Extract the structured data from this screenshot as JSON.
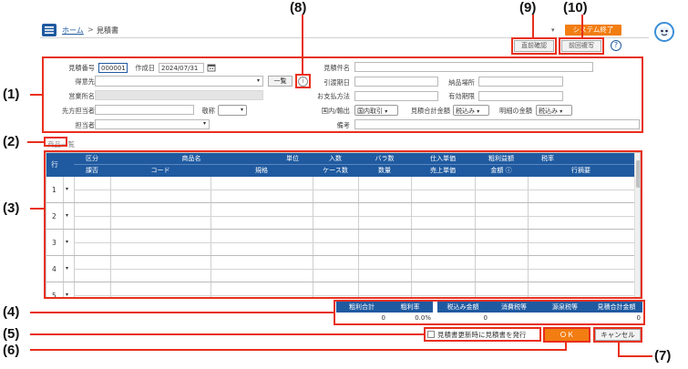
{
  "header": {
    "home_link": "ホーム",
    "separator": ">",
    "page_title": "見積書",
    "exit_button": "システム終了",
    "caret": "▾"
  },
  "toolbar": {
    "prev_confirm": "直前確認",
    "prev_copy": "前回複写",
    "help": "?"
  },
  "callouts": {
    "c1": "(1)",
    "c2": "(2)",
    "c3": "(3)",
    "c4": "(4)",
    "c5": "(5)",
    "c6": "(6)",
    "c7": "(7)",
    "c8": "(8)",
    "c9": "(9)",
    "c10": "(10)"
  },
  "form": {
    "estimate_no_label": "見積番号",
    "estimate_no_value": "000001",
    "created_label": "作成日",
    "created_value": "2024/07/31",
    "customer_label": "得意先",
    "list_button": "一覧",
    "info_icon": "i",
    "office_label": "営業所名",
    "contact_label": "先方担当者",
    "honorific_label": "敬称",
    "staff_label": "担当者",
    "subject_label": "見積件名",
    "delivery_date_label": "引渡期日",
    "delivery_place_label": "納品場所",
    "payment_label": "お支払方法",
    "validity_label": "有効期限",
    "domestic_label": "国内/輸出",
    "domestic_value": "国内取引",
    "total_amount_label": "見積合計金額",
    "total_amount_value": "税込み",
    "detail_amount_label": "明細の金額",
    "detail_amount_value": "税込み",
    "notes_label": "備考"
  },
  "section": {
    "items_title": "商品一覧"
  },
  "table": {
    "row_header": "行",
    "header_top": [
      "区分",
      "商品名",
      "単位",
      "入数",
      "バラ数",
      "仕入単価",
      "粗利益額",
      "税率"
    ],
    "header_bottom": [
      "課否",
      "コード",
      "規格",
      "ケース数",
      "数量",
      "売上単価",
      "金額 ⓘ",
      "行摘要"
    ],
    "rows": [
      "1",
      "2",
      "3",
      "4",
      "5"
    ],
    "row_caret": "▾"
  },
  "totals": {
    "gross_label": "粗利合計",
    "gross_value": "0",
    "rate_label": "粗利率",
    "rate_value": "0.0%",
    "taxin_label": "税込み金額",
    "taxin_value": "0",
    "consumption_label": "消費税等",
    "withholding_label": "源泉税等",
    "grand_label": "見積合計金額",
    "grand_value": "0"
  },
  "footer": {
    "issue_checkbox_label": "見積書更新時に見積書を発行",
    "ok_button": "ＯＫ",
    "cancel_button": "キャンセル"
  },
  "colors": {
    "accent": "#1f5aa0",
    "orange": "#f27d12",
    "annotation": "#e8301c"
  }
}
